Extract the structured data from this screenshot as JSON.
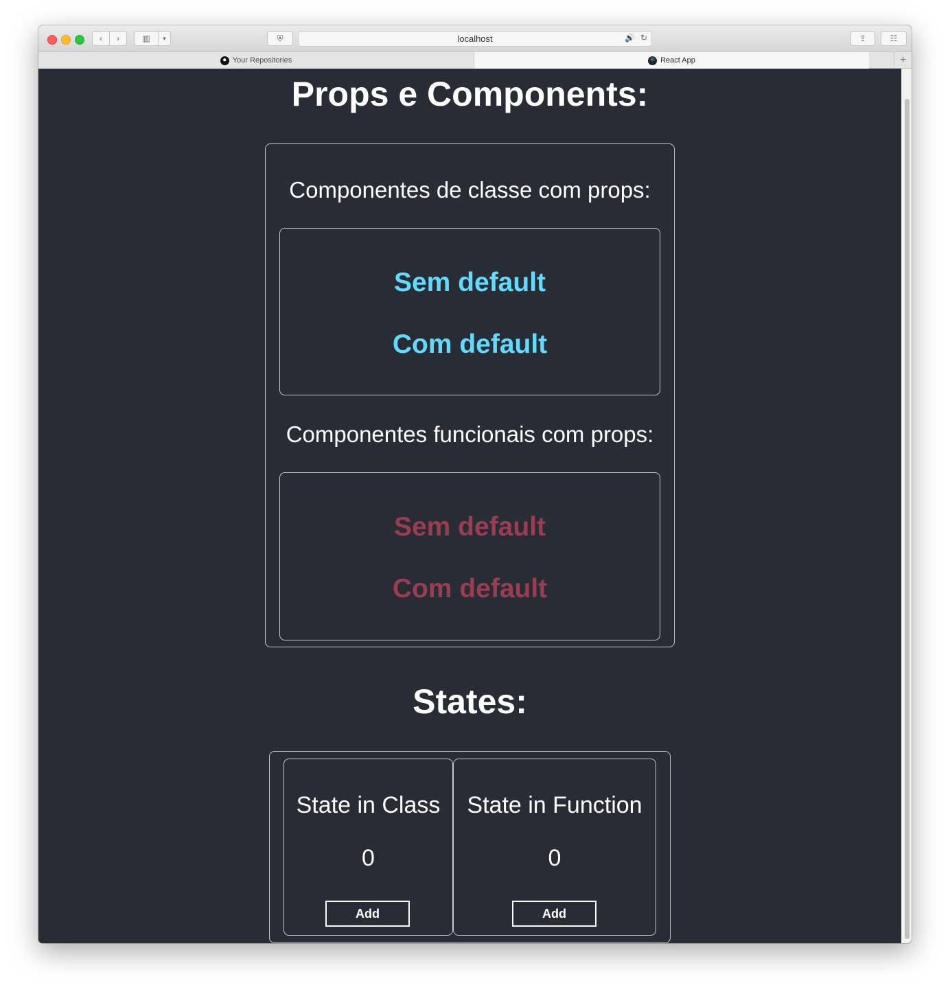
{
  "browser": {
    "url": "localhost",
    "tabs": [
      {
        "label": "Your Repositories",
        "icon": "github-icon",
        "active": false
      },
      {
        "label": "React App",
        "icon": "react-icon",
        "active": true
      }
    ]
  },
  "props_section": {
    "title": "Props e Components:",
    "class_heading": "Componentes de classe com props:",
    "class_items": [
      "Sem default",
      "Com default"
    ],
    "functional_heading": "Componentes funcionais com props:",
    "functional_items": [
      "Sem default",
      "Com default"
    ]
  },
  "states_section": {
    "title": "States:",
    "class_state": {
      "title": "State in Class",
      "count": "0",
      "button_label": "Add"
    },
    "function_state": {
      "title": "State in Function",
      "count": "0",
      "button_label": "Add"
    }
  },
  "colors": {
    "background": "#282c34",
    "class_text": "#61dafb",
    "functional_text": "#9b3d52"
  }
}
